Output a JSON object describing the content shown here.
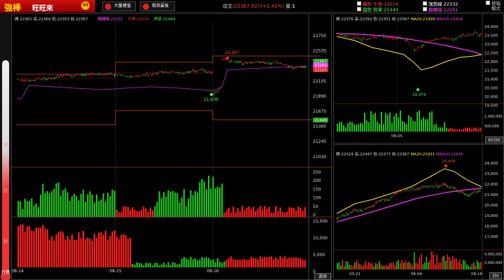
{
  "topbar": {
    "logo_main": "強棒",
    "logo_sub": "旺旺來",
    "logo_badge": "90",
    "btn_market": "大盤權值",
    "btn_futures": "期貨最後",
    "trade_label": "成交:",
    "trade_value": "22367",
    "trade_change": "527(+2.41%)",
    "volume_label": "量:",
    "volume_value": "1",
    "ind_turn_label": "轉折",
    "ind_trend_label": "趨勢",
    "bull_label": "牛角:",
    "bull_value": "22214",
    "bear_label": "熊掌:",
    "bear_value": "21449",
    "strong_label": "強勢線",
    "strong_value": "22332",
    "turn_line_label": "翻轉線",
    "turn_line_value": "22291",
    "switch_label_1": "替箱",
    "switch_label_2": "模式"
  },
  "gauge": {
    "marks": [
      "漲",
      "跌",
      "聯",
      "行情"
    ]
  },
  "main_chart": {
    "header": {
      "open_label": "開:",
      "open": "22361",
      "high_label": "高:",
      "high": "22369",
      "low_label": "低:",
      "low": "22353",
      "close_label": "收:",
      "close": "22367",
      "turn_label": "翻轉線:",
      "turn": "22291",
      "bull_label": "牛角:",
      "bull": "22214",
      "bear_label": "熊掌:",
      "bear": "21449"
    },
    "price_ticks": [
      "22750",
      "22535",
      "22320",
      "22105",
      "21890",
      "21675",
      "21460",
      "21245",
      "21030"
    ],
    "price_tags": {
      "current": "22367",
      "turn": "22291",
      "bull": "22214",
      "bear": "21449"
    },
    "annotations": {
      "high": "22,497",
      "low": "21,639"
    },
    "vol1_ticks": [
      "250",
      "200",
      "150",
      "100",
      "50",
      "0"
    ],
    "vol2_ticks": [
      "15,000",
      "10,000",
      "5,000",
      "0"
    ],
    "date_labels": [
      "08-14",
      "08-15",
      "08-16"
    ],
    "button_label": "還原"
  },
  "right_top": {
    "header": {
      "open_label": "開:",
      "open": "22376",
      "high_label": "高:",
      "high": "22392",
      "low_label": "低:",
      "low": "22351",
      "close_label": "收:",
      "close": "22367",
      "ma20_label": "MA20:",
      "ma20": "21999",
      "ma100_label": "MA100:",
      "ma100": "21916"
    },
    "price_ticks": [
      "24,000",
      "23,500",
      "23,000",
      "22,500",
      "22,000",
      "21,500",
      "21,000",
      "20,500",
      "20,000",
      "19,500"
    ],
    "vol_ticks": [
      "1,000,000",
      "500,000"
    ],
    "annotations": {
      "low": "19,374"
    },
    "date_labels": [
      "08-05"
    ],
    "button_label": "60分K"
  },
  "right_bottom": {
    "header": {
      "open_label": "開:",
      "open": "22324",
      "high_label": "高:",
      "high": "22447",
      "low_label": "低:",
      "low": "22277",
      "close_label": "收:",
      "close": "22367",
      "ma20_label": "MA20:",
      "ma20": "21931",
      "ma100_label": "MA100:",
      "ma100": "21916"
    },
    "price_ticks": [
      "24,000",
      "23,000",
      "22,000",
      "21,000",
      "20,000",
      "19,000",
      "18,000",
      "17,000"
    ],
    "vol_ticks": [
      "4,000,000",
      "2,000,000"
    ],
    "annotations": {
      "high": "24,409",
      "low": "17,500"
    },
    "date_labels": [
      "03-21",
      "06-04",
      "08-16"
    ],
    "button_label": "日K"
  },
  "colors": {
    "up": "#ff2020",
    "down": "#20c020",
    "turn": "#ff33ff",
    "bull": "#ff3030",
    "bear": "#30ff30",
    "ma20": "#ffee33",
    "ma100": "#ff33ff"
  }
}
